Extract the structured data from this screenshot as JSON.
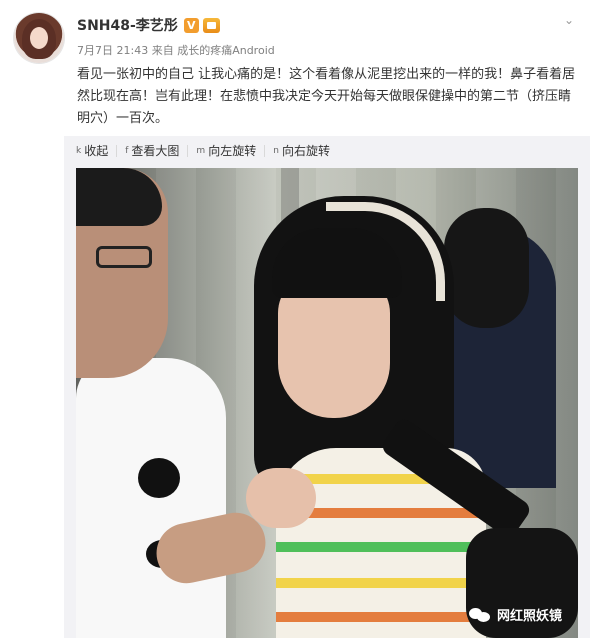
{
  "user": {
    "name": "SNH48-李艺彤",
    "verified_badge": "V",
    "member_icon": "member-crown-icon",
    "more_icon": "chevron-down-icon"
  },
  "post": {
    "date": "7月7日 21:43",
    "source_prefix": "来自",
    "source": "成长的疼痛Android",
    "text": "看见一张初中的自己 让我心痛的是！这个看着像从泥里挖出来的一样的我！鼻子看着居然比现在高！岂有此理！在悲愤中我决定今天开始每天做眼保健操中的第二节（挤压睛明穴）一百次。"
  },
  "toolbar": {
    "collapse": {
      "icon": "k",
      "label": "收起"
    },
    "view_large": {
      "icon": "f",
      "label": "查看大图"
    },
    "rotate_left": {
      "icon": "m",
      "label": "向左旋转"
    },
    "rotate_right": {
      "icon": "n",
      "label": "向右旋转"
    }
  },
  "watermark": {
    "icon": "wechat-icon",
    "label": "网红照妖镜"
  },
  "colors": {
    "accent": "#f29d2e",
    "toolbar_bg": "#f2f2f5",
    "meta_text": "#808080"
  }
}
